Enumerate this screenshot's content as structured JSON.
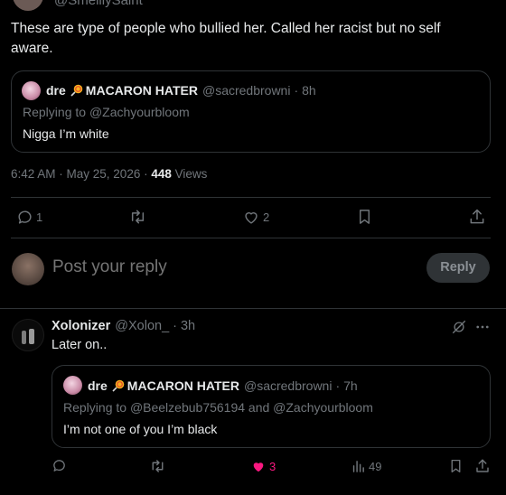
{
  "main_tweet": {
    "top_handle": "@SmelllySaint",
    "text": "These are type of people who bullied her. Called her racist but no self aware.",
    "quote": {
      "name": "dre",
      "name_suffix": "MACARON HATER",
      "handle": "@sacredbrowni",
      "time": "8h",
      "replying_to_label": "Replying to",
      "replying_to": "@Zachyourbloom",
      "text": "Nigga I’m white"
    },
    "timestamp": "6:42 AM · May 25, 2026",
    "views_count": "448",
    "views_label": "Views",
    "actions": {
      "replies": "1",
      "retweets": "",
      "likes": "2"
    }
  },
  "reply_composer": {
    "placeholder": "Post your reply",
    "button_label": "Reply"
  },
  "reply": {
    "name": "Xolonizer",
    "handle": "@Xolon_",
    "time": "3h",
    "text": "Later on..",
    "quote": {
      "name": "dre",
      "name_suffix": "MACARON HATER",
      "handle": "@sacredbrowni",
      "time": "7h",
      "replying_to_label": "Replying to",
      "replying_to_1": "@Beelzebub756194",
      "and_label": "and",
      "replying_to_2": "@Zachyourbloom",
      "text": "I’m not one of you I’m black"
    },
    "actions": {
      "likes": "3",
      "views": "49"
    }
  },
  "colors": {
    "background": "#000000",
    "text": "#e7e9ea",
    "muted": "#71767b",
    "border": "#2f3336",
    "like_pink": "#f91880",
    "link_blue": "#1d9bf0"
  },
  "icons": [
    "reply-icon",
    "retweet-icon",
    "heart-icon",
    "bookmark-icon",
    "share-icon",
    "grok-icon",
    "more-icon",
    "views-icon",
    "lollipop-emoji"
  ]
}
